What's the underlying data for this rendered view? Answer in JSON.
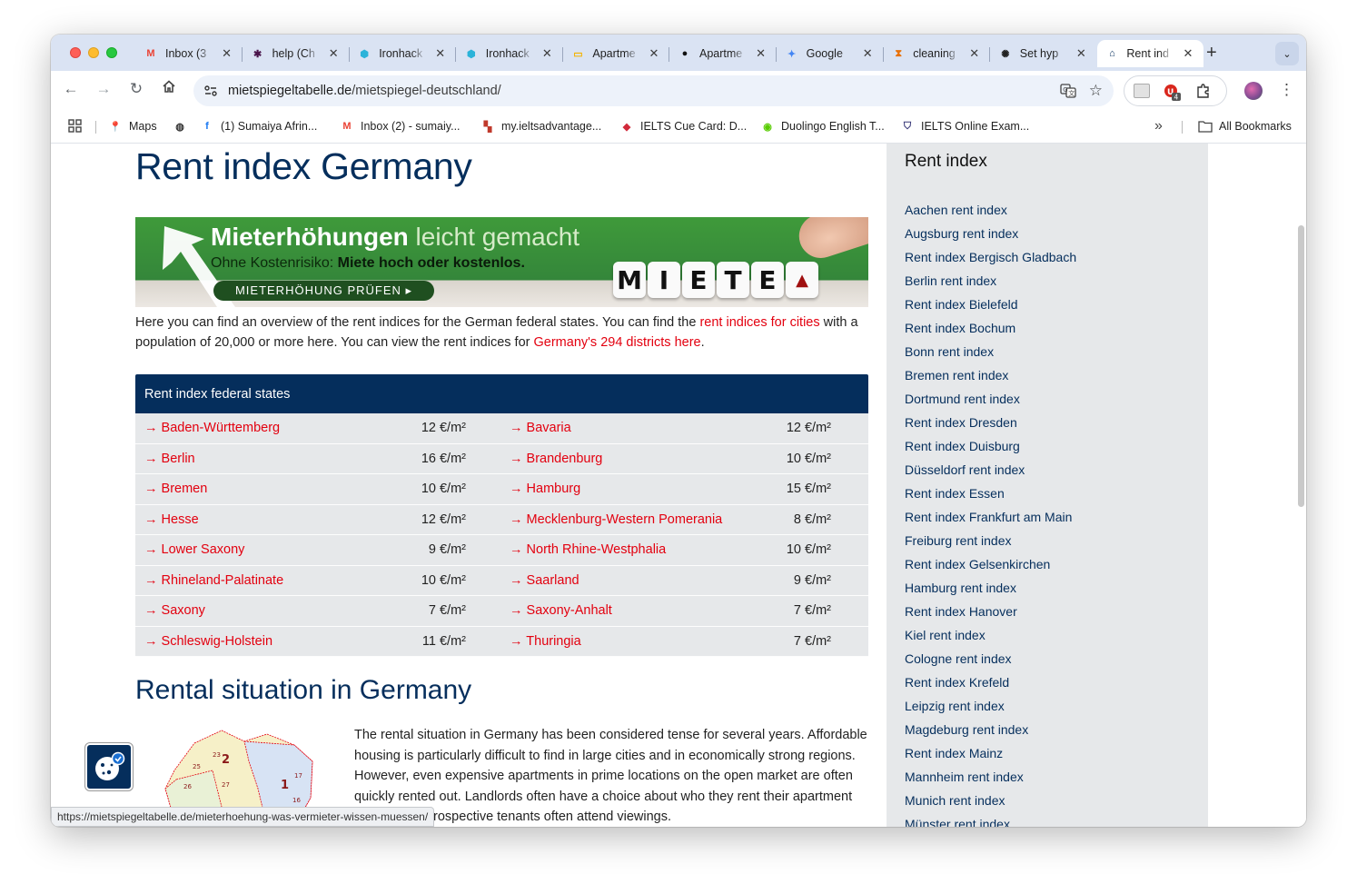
{
  "browser": {
    "tabs": [
      {
        "title": "Inbox (3",
        "icon": "gmail-icon",
        "color": "#ea4335"
      },
      {
        "title": "help (Ch",
        "icon": "slack-icon",
        "color": "#4a154b"
      },
      {
        "title": "Ironhack",
        "icon": "ironhack-icon",
        "color": "#2bb3d9"
      },
      {
        "title": "Ironhack",
        "icon": "ironhack-icon",
        "color": "#2bb3d9"
      },
      {
        "title": "Apartme",
        "icon": "slides-icon",
        "color": "#f4b400"
      },
      {
        "title": "Apartme",
        "icon": "github-icon",
        "color": "#111111"
      },
      {
        "title": "Google",
        "icon": "gemini-icon",
        "color": "#4285f4"
      },
      {
        "title": "cleaning",
        "icon": "hourglass-icon",
        "color": "#e8710a"
      },
      {
        "title": "Set hyp",
        "icon": "openai-icon",
        "color": "#222222"
      },
      {
        "title": "Rent ind",
        "icon": "house-icon",
        "color": "#052e5c"
      }
    ],
    "active_tab": 9,
    "url_host": "mietspiegeltabelle.de",
    "url_path": "/mietspiegel-deutschland/",
    "extension_badge": "4",
    "bookmarks": [
      {
        "label": "Maps",
        "icon": "maps-pin-icon"
      },
      {
        "label": "",
        "icon": "globe-icon"
      },
      {
        "label": "(1) Sumaiya Afrin...",
        "icon": "facebook-icon"
      },
      {
        "label": "Inbox (2) - sumaiy...",
        "icon": "gmail-icon"
      },
      {
        "label": "my.ieltsadvantage...",
        "icon": "ielts-icon"
      },
      {
        "label": "IELTS Cue Card: D...",
        "icon": "ielts-cue-icon"
      },
      {
        "label": "Duolingo English T...",
        "icon": "duolingo-icon"
      },
      {
        "label": "IELTS Online Exam...",
        "icon": "shield-icon"
      }
    ],
    "all_bookmarks": "All Bookmarks",
    "overflow": "»"
  },
  "page": {
    "title": "Rent index Germany",
    "banner": {
      "headline_bold": "Mieterhöhungen",
      "headline_light": "leicht gemacht",
      "sub_plain": "Ohne Kostenrisiko:",
      "sub_bold": "Miete hoch oder kostenlos.",
      "button": "MIETERHÖHUNG PRÜFEN ▸",
      "dice": [
        "M",
        "I",
        "E",
        "T",
        "E"
      ]
    },
    "intro": {
      "p1": "Here you can find an overview of the rent indices for the German federal states. You can find the ",
      "link1": "rent indices for cities",
      "p2": " with a population of 20,000 or more here. You can view the rent indices for ",
      "link2": "Germany's 294 districts here",
      "p3": "."
    },
    "states_table": {
      "heading": "Rent index federal states",
      "rows": [
        {
          "left_name": "→ Baden-Württemberg",
          "left_value": "12 €/m²",
          "right_name": "→ Bavaria",
          "right_value": "12 €/m²"
        },
        {
          "left_name": "→ Berlin",
          "left_value": "16 €/m²",
          "right_name": "→ Brandenburg",
          "right_value": "10 €/m²"
        },
        {
          "left_name": "→ Bremen",
          "left_value": "10 €/m²",
          "right_name": "→ Hamburg",
          "right_value": "15 €/m²"
        },
        {
          "left_name": "→ Hesse",
          "left_value": "12 €/m²",
          "right_name": "→ Mecklenburg-Western Pomerania",
          "right_value": "8 €/m²"
        },
        {
          "left_name": "→ Lower Saxony",
          "left_value": "9 €/m²",
          "right_name": "→ North Rhine-Westphalia",
          "right_value": "10 €/m²"
        },
        {
          "left_name": "→ Rhineland-Palatinate",
          "left_value": "10 €/m²",
          "right_name": "→ Saarland",
          "right_value": "9 €/m²"
        },
        {
          "left_name": "→ Saxony",
          "left_value": "7 €/m²",
          "right_name": "→ Saxony-Anhalt",
          "right_value": "7 €/m²"
        },
        {
          "left_name": "→ Schleswig-Holstein",
          "left_value": "11 €/m²",
          "right_name": "→ Thuringia",
          "right_value": "7 €/m²"
        }
      ]
    },
    "section_title": "Rental situation in Germany",
    "article": "The rental situation in Germany has been considered tense for several years. Affordable housing is particularly difficult to find in large cities and in economically strong regions. However, even expensive apartments in prime locations on the open market are often quickly rented out. Landlords often have a choice about who they rent their apartment to, as many prospective tenants often attend viewings.",
    "map_labels": [
      "2",
      "1",
      "23",
      "25",
      "27",
      "17",
      "26",
      "16"
    ],
    "sidebar": {
      "title": "Rent index",
      "links": [
        "Aachen rent index",
        "Augsburg rent index",
        "Rent index Bergisch Gladbach",
        "Berlin rent index",
        "Rent index Bielefeld",
        "Rent index Bochum",
        "Bonn rent index",
        "Bremen rent index",
        "Dortmund rent index",
        "Rent index Dresden",
        "Rent index Duisburg",
        "Düsseldorf rent index",
        "Rent index Essen",
        "Rent index Frankfurt am Main",
        "Freiburg rent index",
        "Rent index Gelsenkirchen",
        "Hamburg rent index",
        "Rent index Hanover",
        "Kiel rent index",
        "Cologne rent index",
        "Rent index Krefeld",
        "Leipzig rent index",
        "Magdeburg rent index",
        "Rent index Mainz",
        "Mannheim rent index",
        "Munich rent index",
        "Münster rent index"
      ]
    },
    "status_url": "https://mietspiegeltabelle.de/mieterhoehung-was-vermieter-wissen-muessen/",
    "colors": {
      "navy": "#052e5c",
      "link_red": "#e3000f",
      "table_bg": "#e6e8ea"
    }
  }
}
